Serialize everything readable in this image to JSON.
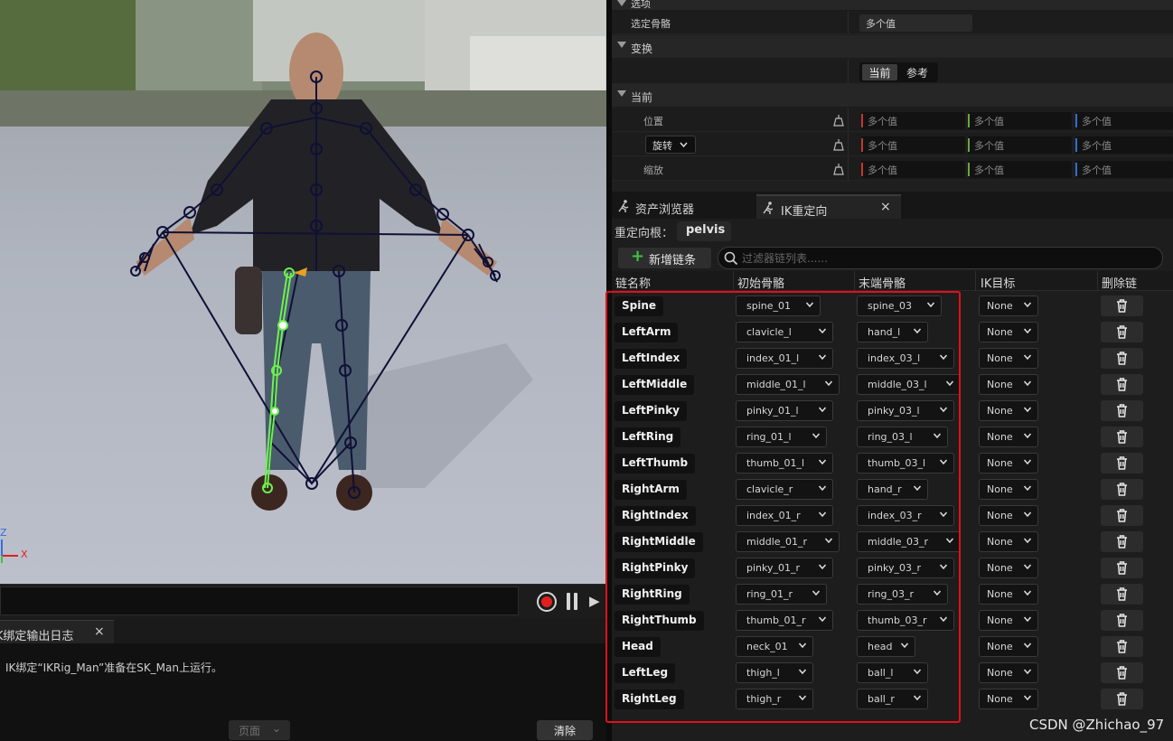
{
  "details": {
    "sections": {
      "top": "选项",
      "transform": "变换",
      "current": "当前"
    },
    "selected_bone": {
      "label": "选定骨骼",
      "value": "多个值"
    },
    "space_toggle": {
      "current": "当前",
      "reference": "参考"
    },
    "rows": [
      {
        "label": "位置",
        "values": [
          "多个值",
          "多个值",
          "多个值"
        ]
      },
      {
        "label": "旋转",
        "values": [
          "多个值",
          "多个值",
          "多个值"
        ]
      },
      {
        "label": "缩放",
        "values": [
          "多个值",
          "多个值",
          "多个值"
        ]
      }
    ],
    "axis_colors": [
      "#c0392b",
      "#6aa73a",
      "#2f6fd0"
    ]
  },
  "tabs": [
    {
      "label": "资产浏览器",
      "icon": "running-man-icon"
    },
    {
      "label": "IK重定向",
      "icon": "running-man-icon",
      "close": "×"
    }
  ],
  "retarget": {
    "root_label": "重定向根：",
    "root_value": "pelvis",
    "add_chain_label": "新增链条",
    "filter_placeholder": "过滤器链列表......",
    "columns": [
      "链名称",
      "初始骨骼",
      "末端骨骼",
      "IK目标",
      "删除链"
    ],
    "chains": [
      {
        "name": "Spine",
        "start": "spine_01",
        "end": "spine_03",
        "goal": "None"
      },
      {
        "name": "LeftArm",
        "start": "clavicle_l",
        "end": "hand_l",
        "goal": "None"
      },
      {
        "name": "LeftIndex",
        "start": "index_01_l",
        "end": "index_03_l",
        "goal": "None"
      },
      {
        "name": "LeftMiddle",
        "start": "middle_01_l",
        "end": "middle_03_l",
        "goal": "None"
      },
      {
        "name": "LeftPinky",
        "start": "pinky_01_l",
        "end": "pinky_03_l",
        "goal": "None"
      },
      {
        "name": "LeftRing",
        "start": "ring_01_l",
        "end": "ring_03_l",
        "goal": "None"
      },
      {
        "name": "LeftThumb",
        "start": "thumb_01_l",
        "end": "thumb_03_l",
        "goal": "None"
      },
      {
        "name": "RightArm",
        "start": "clavicle_r",
        "end": "hand_r",
        "goal": "None"
      },
      {
        "name": "RightIndex",
        "start": "index_01_r",
        "end": "index_03_r",
        "goal": "None"
      },
      {
        "name": "RightMiddle",
        "start": "middle_01_r",
        "end": "middle_03_r",
        "goal": "None"
      },
      {
        "name": "RightPinky",
        "start": "pinky_01_r",
        "end": "pinky_03_r",
        "goal": "None"
      },
      {
        "name": "RightRing",
        "start": "ring_01_r",
        "end": "ring_03_r",
        "goal": "None"
      },
      {
        "name": "RightThumb",
        "start": "thumb_01_r",
        "end": "thumb_03_r",
        "goal": "None"
      },
      {
        "name": "Head",
        "start": "neck_01",
        "end": "head",
        "goal": "None"
      },
      {
        "name": "LeftLeg",
        "start": "thigh_l",
        "end": "ball_l",
        "goal": "None"
      },
      {
        "name": "RightLeg",
        "start": "thigh_r",
        "end": "ball_r",
        "goal": "None"
      }
    ]
  },
  "viewport": {
    "axis_z": "Z",
    "axis_x": "X"
  },
  "log": {
    "tab_label": "IK绑定输出日志",
    "close": "×",
    "line": "IK绑定“IKRig_Man”准备在SK_Man上运行。",
    "page_label": "页面",
    "clear_label": "清除"
  },
  "watermark": "CSDN @Zhichao_97",
  "colors": {
    "accent_green": "#3ec43e",
    "highlight_red": "#e0101a",
    "bone_dark": "#101035",
    "bone_selected": "#6cf24f"
  }
}
